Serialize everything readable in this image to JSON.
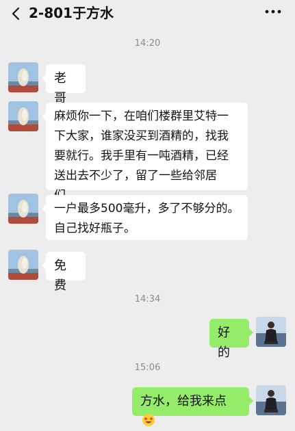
{
  "header": {
    "title": "2-801于方水"
  },
  "timestamps": [
    "14:20",
    "14:34",
    "15:06"
  ],
  "messages": [
    {
      "side": "left",
      "text": "老哥"
    },
    {
      "side": "left",
      "lines": [
        "麻烦你一下，在咱们楼群里艾特一",
        "下大家，谁家没买到酒精的，找我",
        "要就行。我手里有一吨酒精，已经",
        "送出去不少了，留了一些给邻居们。"
      ]
    },
    {
      "side": "left",
      "lines": [
        "一户最多500毫升，多了不够分的。",
        "自己找好瓶子。"
      ]
    },
    {
      "side": "left",
      "text": "免费"
    },
    {
      "side": "right",
      "text": "好的"
    },
    {
      "side": "right",
      "text": "方水，给我来点",
      "emoji": "star-struck-emoji"
    }
  ],
  "colors": {
    "background": "#ededed",
    "incoming_bubble": "#ffffff",
    "outgoing_bubble": "#95ec69",
    "timestamp": "#8c8c8c"
  },
  "icons": [
    "back-icon",
    "more-icon"
  ]
}
